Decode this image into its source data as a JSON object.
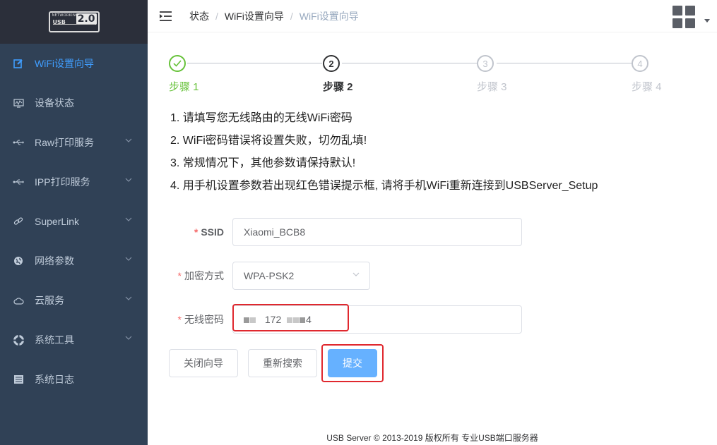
{
  "logo": {
    "top_text": "NETWORKING",
    "usb_text": "USB",
    "version": "2.0"
  },
  "sidebar": {
    "items": [
      {
        "label": "WiFi设置向导",
        "icon": "edit-icon",
        "active": true,
        "has_submenu": false
      },
      {
        "label": "设备状态",
        "icon": "monitor-icon",
        "active": false,
        "has_submenu": false
      },
      {
        "label": "Raw打印服务",
        "icon": "usb-icon",
        "active": false,
        "has_submenu": true
      },
      {
        "label": "IPP打印服务",
        "icon": "usb-icon",
        "active": false,
        "has_submenu": true
      },
      {
        "label": "SuperLink",
        "icon": "link-icon",
        "active": false,
        "has_submenu": true
      },
      {
        "label": "网络参数",
        "icon": "globe-icon",
        "active": false,
        "has_submenu": true
      },
      {
        "label": "云服务",
        "icon": "cloud-icon",
        "active": false,
        "has_submenu": true
      },
      {
        "label": "系统工具",
        "icon": "lifebuoy-icon",
        "active": false,
        "has_submenu": true
      },
      {
        "label": "系统日志",
        "icon": "list-icon",
        "active": false,
        "has_submenu": false
      }
    ]
  },
  "header": {
    "breadcrumb": [
      "状态",
      "WiFi设置向导",
      "WiFi设置向导"
    ]
  },
  "steps": [
    {
      "number": "1",
      "title": "步骤 1",
      "status": "done"
    },
    {
      "number": "2",
      "title": "步骤 2",
      "status": "active"
    },
    {
      "number": "3",
      "title": "步骤 3",
      "status": "wait"
    },
    {
      "number": "4",
      "title": "步骤 4",
      "status": "wait"
    }
  ],
  "notes": [
    "1. 请填写您无线路由的无线WiFi密码",
    "2. WiFi密码错误将设置失败，切勿乱填!",
    "3. 常规情况下，其他参数请保持默认!",
    "4. 用手机设置参数若出现红色错误提示框, 请将手机WiFi重新连接到USBServer_Setup"
  ],
  "form": {
    "ssid": {
      "label": "SSID",
      "value": "Xiaomi_BCB8"
    },
    "encryption": {
      "label": "加密方式",
      "value": "WPA-PSK2"
    },
    "password": {
      "label": "无线密码",
      "visible_part_1": "172",
      "visible_part_2": "4"
    }
  },
  "buttons": {
    "close": "关闭向导",
    "rescan": "重新搜索",
    "submit": "提交"
  },
  "footer": "USB Server © 2013-2019 版权所有 专业USB端口服务器",
  "colors": {
    "sidebar_bg": "#304156",
    "active": "#409eff",
    "done": "#67c23a",
    "primary_button": "#66b1ff",
    "highlight_border": "#e0282e"
  }
}
